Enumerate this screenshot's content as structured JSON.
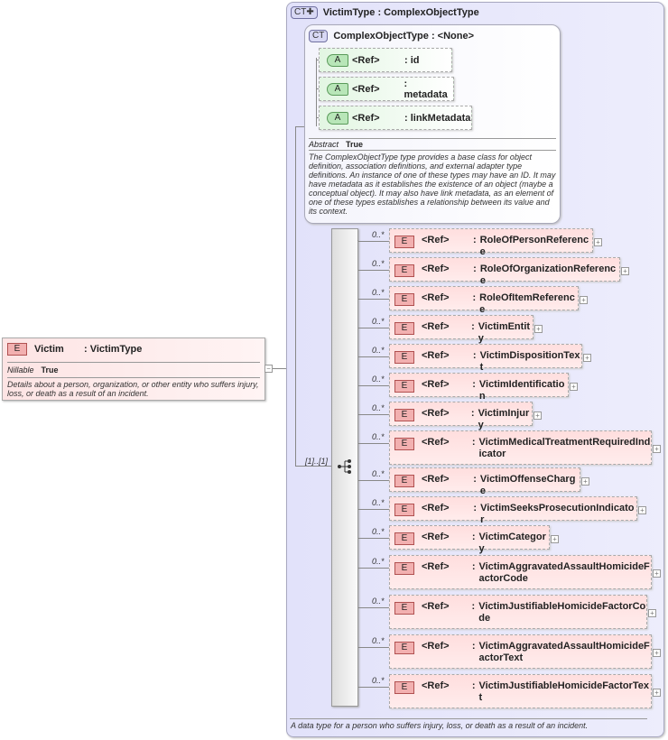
{
  "victim": {
    "badge": "E",
    "name": "Victim",
    "type": ": VictimType",
    "nillable_label": "Nillable",
    "nillable_value": "True",
    "doc": "Details about a person, organization, or other entity who suffers injury, loss, or death as a result of an incident.",
    "collapse": "−"
  },
  "victim_type": {
    "badge": "CT✚",
    "title": "VictimType : ComplexObjectType",
    "doc": "A data type for a person who suffers injury, loss, or death as a result of an incident."
  },
  "complex_object_type": {
    "badge": "CT",
    "title": "ComplexObjectType : <None>",
    "abstract_label": "Abstract",
    "abstract_value": "True",
    "doc": "The ComplexObjectType type provides a base class for object definition, association definitions, and external adapter type definitions. An instance of one of these types may have an ID. It may have metadata as it establishes the existence of an object (maybe a conceptual object). It may also have link metadata, as an element of one of these types establishes a relationship between its value and its context.",
    "attributes": [
      {
        "badge": "A",
        "ref": "<Ref>",
        "name": ": id"
      },
      {
        "badge": "A",
        "ref": "<Ref>",
        "name": ": metadata"
      },
      {
        "badge": "A",
        "ref": "<Ref>",
        "name": ": linkMetadata"
      }
    ]
  },
  "sequence": {
    "multiplicity": "[1]..[1]"
  },
  "elements": [
    {
      "mult": "0..*",
      "badge": "E",
      "ref": "<Ref>",
      "name": "RoleOfPersonReference"
    },
    {
      "mult": "0..*",
      "badge": "E",
      "ref": "<Ref>",
      "name": "RoleOfOrganizationReference"
    },
    {
      "mult": "0..*",
      "badge": "E",
      "ref": "<Ref>",
      "name": "RoleOfItemReference"
    },
    {
      "mult": "0..*",
      "badge": "E",
      "ref": "<Ref>",
      "name": "VictimEntity"
    },
    {
      "mult": "0..*",
      "badge": "E",
      "ref": "<Ref>",
      "name": "VictimDispositionText"
    },
    {
      "mult": "0..*",
      "badge": "E",
      "ref": "<Ref>",
      "name": "VictimIdentification"
    },
    {
      "mult": "0..*",
      "badge": "E",
      "ref": "<Ref>",
      "name": "VictimInjury"
    },
    {
      "mult": "0..*",
      "badge": "E",
      "ref": "<Ref>",
      "name": "VictimMedicalTreatmentRequiredIndicator"
    },
    {
      "mult": "0..*",
      "badge": "E",
      "ref": "<Ref>",
      "name": "VictimOffenseCharge"
    },
    {
      "mult": "0..*",
      "badge": "E",
      "ref": "<Ref>",
      "name": "VictimSeeksProsecutionIndicator"
    },
    {
      "mult": "0..*",
      "badge": "E",
      "ref": "<Ref>",
      "name": "VictimCategory"
    },
    {
      "mult": "0..*",
      "badge": "E",
      "ref": "<Ref>",
      "name": "VictimAggravatedAssaultHomicideFactorCode"
    },
    {
      "mult": "0..*",
      "badge": "E",
      "ref": "<Ref>",
      "name": "VictimJustifiableHomicideFactorCode"
    },
    {
      "mult": "0..*",
      "badge": "E",
      "ref": "<Ref>",
      "name": "VictimAggravatedAssaultHomicideFactorText"
    },
    {
      "mult": "0..*",
      "badge": "E",
      "ref": "<Ref>",
      "name": "VictimJustifiableHomicideFactorText"
    }
  ],
  "expand": "+"
}
